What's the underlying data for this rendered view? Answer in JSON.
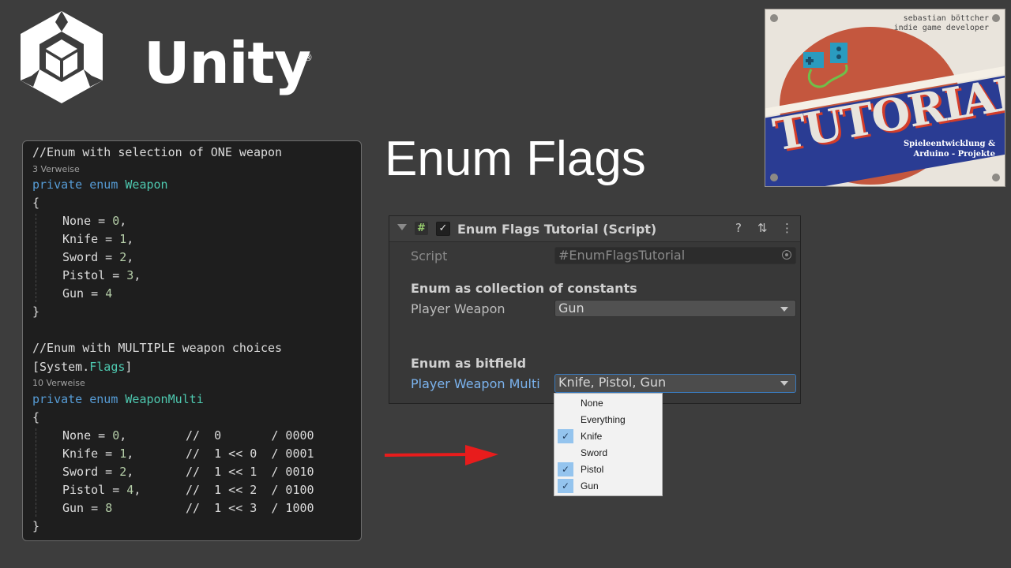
{
  "logo": {
    "word": "Unity",
    "reg": "®"
  },
  "title": "Enum Flags",
  "badge": {
    "author_line1": "sebastian böttcher",
    "author_line2": "indie game developer",
    "word": "TUTORIALS",
    "sub_line1": "Spieleentwicklung &",
    "sub_line2": "Arduino - Projekte"
  },
  "code": {
    "comment1": "//Enum with selection of ONE weapon",
    "refs1": "3 Verweise",
    "decl1_kw": "private enum",
    "decl1_name": "Weapon",
    "open": "{",
    "close": "}",
    "enum1": [
      {
        "name": "None",
        "eq": " = ",
        "val": "0",
        "end": ","
      },
      {
        "name": "Knife",
        "eq": " = ",
        "val": "1",
        "end": ","
      },
      {
        "name": "Sword",
        "eq": " = ",
        "val": "2",
        "end": ","
      },
      {
        "name": "Pistol",
        "eq": " = ",
        "val": "3",
        "end": ","
      },
      {
        "name": "Gun",
        "eq": " = ",
        "val": "4",
        "end": ""
      }
    ],
    "comment2": "//Enum with MULTIPLE weapon choices",
    "attr_open": "[System.",
    "attr_name": "Flags",
    "attr_close": "]",
    "refs2": "10 Verweise",
    "decl2_kw": "private enum",
    "decl2_name": "WeaponMulti",
    "enum2": [
      {
        "name": "None",
        "eq": " = ",
        "val": "0",
        "end": ",",
        "comment": "//  0       / 0000"
      },
      {
        "name": "Knife",
        "eq": " = ",
        "val": "1",
        "end": ",",
        "comment": "//  1 << 0  / 0001"
      },
      {
        "name": "Sword",
        "eq": " = ",
        "val": "2",
        "end": ",",
        "comment": "//  1 << 1  / 0010"
      },
      {
        "name": "Pistol",
        "eq": " = ",
        "val": "4",
        "end": ",",
        "comment": "//  1 << 2  / 0100"
      },
      {
        "name": "Gun",
        "eq": " = ",
        "val": "8",
        "end": "",
        "comment": "//  1 << 3  / 1000"
      }
    ]
  },
  "inspector": {
    "component_title": "Enum Flags Tutorial (Script)",
    "hash_icon": "#",
    "enabled_check": "✓",
    "help_icon": "?",
    "settings_icon": "⇅",
    "more_icon": "⋮",
    "script_label": "Script",
    "script_value": "EnumFlagsTutorial",
    "script_icon": "#",
    "section1": "Enum as collection of constants",
    "weapon_label": "Player Weapon",
    "weapon_value": "Gun",
    "section2": "Enum as bitfield",
    "multi_label": "Player Weapon Multi",
    "multi_value": "Knife, Pistol, Gun"
  },
  "menu": {
    "items": [
      {
        "label": "None",
        "checked": false,
        "mark": ""
      },
      {
        "label": "Everything",
        "checked": false,
        "mark": ""
      },
      {
        "label": "Knife",
        "checked": true,
        "mark": "✓"
      },
      {
        "label": "Sword",
        "checked": false,
        "mark": ""
      },
      {
        "label": "Pistol",
        "checked": true,
        "mark": "✓"
      },
      {
        "label": "Gun",
        "checked": true,
        "mark": "✓"
      }
    ]
  },
  "colors": {
    "comment": "#57a64a",
    "keyword": "#569cd6",
    "type": "#4ec9b0",
    "arrow": "#e81c1c",
    "focus_label": "#7bb3ee",
    "check_highlight": "#94c4ee"
  }
}
